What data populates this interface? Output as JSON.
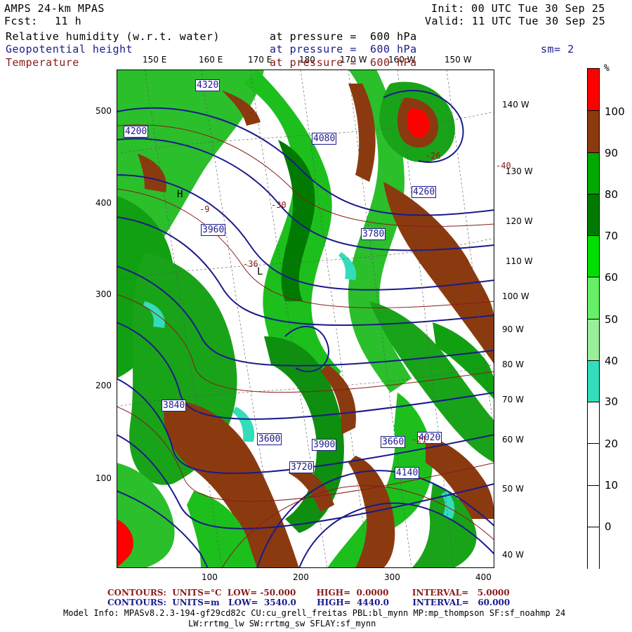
{
  "header": {
    "title": "AMPS 24-km MPAS",
    "fcst_label": "Fcst:",
    "fcst_value": "11 h",
    "init": "Init: 00 UTC Tue 30 Sep 25",
    "valid": "Valid: 11 UTC Tue 30 Sep 25"
  },
  "fields": [
    {
      "name": "Relative humidity (w.r.t. water)",
      "level": "at pressure =  600 hPa",
      "color": "#000000"
    },
    {
      "name": "Geopotential height",
      "level": "at pressure =  600 hPa",
      "color": "#1a1a8c"
    },
    {
      "name": "Temperature",
      "level": "at pressure =  600 hPa",
      "color": "#8b1a1a"
    }
  ],
  "smoothing": "sm= 2",
  "map": {
    "top_longitudes": [
      "150 E",
      "160 E",
      "170 E",
      "180",
      "170 W",
      "160 W",
      "150 W"
    ],
    "right_longitudes": [
      "140 W",
      "130 W",
      "120 W",
      "110 W",
      "100 W",
      "90 W",
      "80 W",
      "70 W",
      "60 W",
      "50 W",
      "40 W"
    ],
    "y_ticks": [
      "500",
      "400",
      "300",
      "200",
      "100"
    ],
    "x_ticks": [
      "100",
      "200",
      "300",
      "400"
    ],
    "height_labels": [
      "4320",
      "4200",
      "4080",
      "4260",
      "3960",
      "3780",
      "3840",
      "3900",
      "3720",
      "4140",
      "4020",
      "3660",
      "3600"
    ],
    "temp_labels": [
      "-40",
      "-30",
      "-36",
      "-26",
      "-21",
      "-9"
    ],
    "highs_lows": [
      "H",
      "L"
    ]
  },
  "colorbar": {
    "unit": "%",
    "labels": [
      "100",
      "90",
      "80",
      "70",
      "60",
      "50",
      "40",
      "30",
      "20",
      "10",
      "0"
    ],
    "colors": [
      "#ff0000",
      "#8b3a0f",
      "#00aa00",
      "#007a00",
      "#00e000",
      "#66ee66",
      "#99ee99",
      "#33ddbb",
      "#ffffff",
      "#ffffff",
      "#ffffff",
      "#ffffff"
    ]
  },
  "footer": {
    "temp_contours": "CONTOURS:  UNITS=°C  LOW= -50.000       HIGH=  0.0000        INTERVAL=   5.0000",
    "height_contours": "CONTOURS:  UNITS=m   LOW=  3540.0       HIGH=  4440.0        INTERVAL=   60.000",
    "model_info_1": "Model Info: MPASv8.2.3-194-gf29cd82c CU:cu_grell_freitas PBL:bl_mynn MP:mp_thompson SF:sf_noahmp 24",
    "model_info_2": "LW:rrtmg_lw SW:rrtmg_sw SFLAY:sf_mynn"
  }
}
